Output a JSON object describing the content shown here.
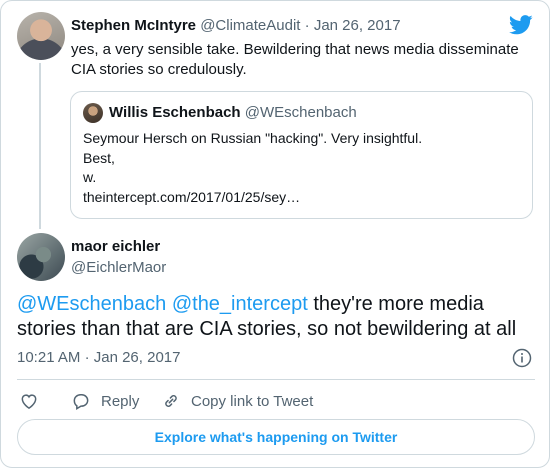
{
  "parent_tweet": {
    "name": "Stephen McIntyre",
    "handle": "@ClimateAudit",
    "separator": "·",
    "date": "Jan 26, 2017",
    "text": "yes, a very sensible take. Bewildering that news media disseminate CIA stories so credulously."
  },
  "quoted_tweet": {
    "name": "Willis Eschenbach",
    "handle": "@WEschenbach",
    "lines": [
      "Seymour Hersch on Russian \"hacking\". Very insightful.",
      "Best,",
      "w.",
      "theintercept.com/2017/01/25/sey…"
    ]
  },
  "main_tweet": {
    "name": "maor eichler",
    "handle": "@EichlerMaor",
    "mention_1": "@WEschenbach",
    "mention_2": "@the_intercept",
    "text": " they're more media stories than that are CIA stories, so not bewildering at all",
    "time": "10:21 AM",
    "separator": "·",
    "date": "Jan 26, 2017"
  },
  "actions": {
    "reply_label": "Reply",
    "copy_label": "Copy link to Tweet"
  },
  "explore_label": "Explore what's happening on Twitter",
  "icons": {
    "logo": "twitter-bird-icon",
    "like": "heart-icon",
    "reply": "speech-bubble-icon",
    "copy": "link-icon",
    "info": "info-icon"
  },
  "colors": {
    "accent": "#1d9bf0",
    "secondary_text": "#536471",
    "border": "#cfd9de"
  }
}
